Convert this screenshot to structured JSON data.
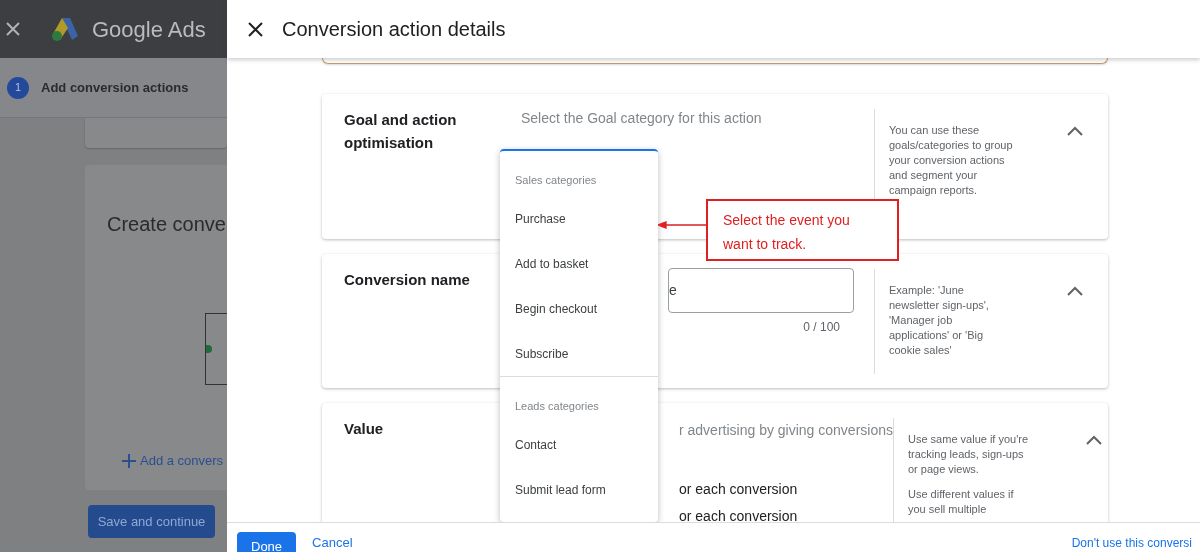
{
  "background_page": {
    "app_name": "Google Ads",
    "step": {
      "number": "1",
      "label": "Add conversion actions"
    },
    "card_title": "Create conve",
    "add_link": "Add a convers",
    "save_button": "Save and continue"
  },
  "drawer": {
    "title": "Conversion action details",
    "sections": [
      {
        "kind": "goal",
        "title": "Goal and action optimisation",
        "prompt": "Select the Goal category for this action",
        "help": "You can use these goals/categories to group your conversion actions and segment your campaign reports.",
        "expanded": true
      },
      {
        "kind": "name",
        "title": "Conversion name",
        "input_value": "e",
        "counter": "0 / 100",
        "help": "Example: 'June newsletter sign-ups', 'Manager job applications' or 'Big cookie sales'",
        "expanded": true
      },
      {
        "kind": "value",
        "title": "Value",
        "prompt": "r advertising by giving conversions",
        "options": [
          "or each conversion",
          "or each conversion"
        ],
        "help": "Use same value if you're tracking leads, sign-ups or page views.",
        "help_2": "Use different values if you sell multiple",
        "expanded": true
      }
    ],
    "dropdown": {
      "groups": [
        {
          "heading": "Sales categories",
          "items": [
            "Purchase",
            "Add to basket",
            "Begin checkout",
            "Subscribe"
          ]
        },
        {
          "heading": "Leads categories",
          "items": [
            "Contact",
            "Submit lead form"
          ]
        }
      ]
    },
    "annotation": "Select the event you want to track.",
    "footer": {
      "done": "Done",
      "cancel": "Cancel",
      "secondary": "Don't use this conversi"
    }
  }
}
